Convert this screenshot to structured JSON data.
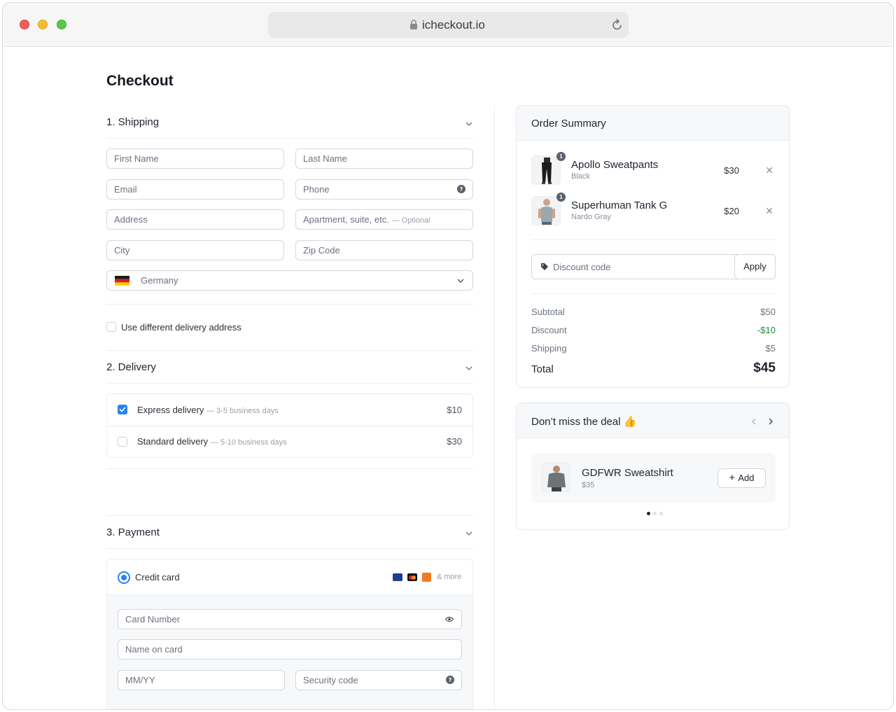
{
  "browser": {
    "url": "icheckout.io"
  },
  "page": {
    "title": "Checkout"
  },
  "shipping": {
    "title": "1. Shipping",
    "first_name_ph": "First Name",
    "last_name_ph": "Last Name",
    "email_ph": "Email",
    "phone_ph": "Phone",
    "address_ph": "Address",
    "apartment_ph": "Apartment, suite, etc.",
    "apartment_optional": "— Optional",
    "city_ph": "City",
    "zip_ph": "Zip Code",
    "country": "Germany",
    "different_delivery": "Use different delivery address"
  },
  "delivery": {
    "title": "2. Delivery",
    "options": [
      {
        "name": "Express delivery",
        "eta": "— 3-5 business days",
        "price": "$10",
        "checked": true
      },
      {
        "name": "Standard delivery",
        "eta": "— 5-10 business days",
        "price": "$30",
        "checked": false
      }
    ]
  },
  "payment": {
    "title": "3. Payment",
    "method": "Credit card",
    "more": "& more",
    "card_number_ph": "Card Number",
    "name_on_card_ph": "Name on card",
    "expiry_ph": "MM/YY",
    "security_ph": "Security code"
  },
  "summary": {
    "title": "Order Summary",
    "items": [
      {
        "name": "Apollo Sweatpants",
        "variant": "Black",
        "price": "$30",
        "qty": "1"
      },
      {
        "name": "Superhuman Tank G",
        "variant": "Nardo Gray",
        "price": "$20",
        "qty": "1"
      }
    ],
    "discount_ph": "Discount code",
    "apply_label": "Apply",
    "subtotal_label": "Subtotal",
    "subtotal": "$50",
    "discount_label": "Discount",
    "discount": "-$10",
    "shipping_label": "Shipping",
    "shipping": "$5",
    "total_label": "Total",
    "total": "$45"
  },
  "deal": {
    "title": "Don’t miss the deal 👍",
    "product": "GDFWR Sweatshirt",
    "price": "$35",
    "add_label": "Add"
  },
  "colors": {
    "accent": "#2684f1",
    "discount_green": "#1f8a3b"
  }
}
